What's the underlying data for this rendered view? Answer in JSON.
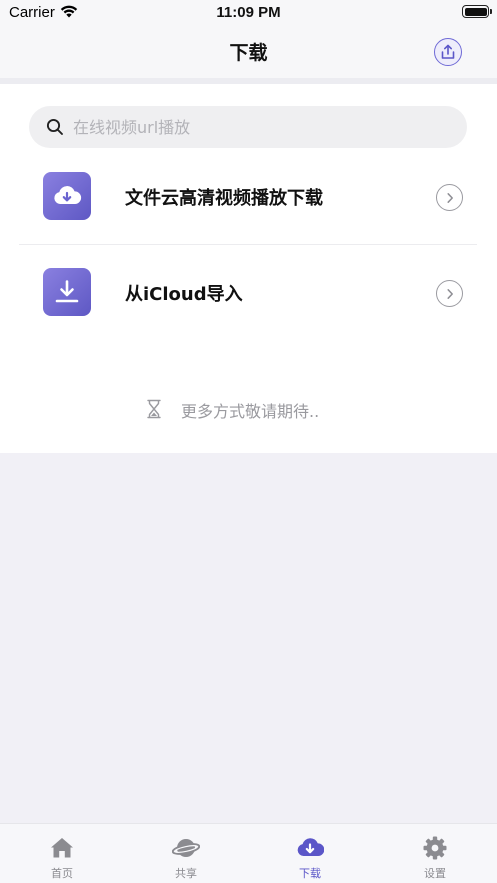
{
  "status_bar": {
    "carrier": "Carrier",
    "time": "11:09 PM"
  },
  "nav": {
    "title": "下载"
  },
  "search": {
    "placeholder": "在线视频url播放"
  },
  "list": [
    {
      "label": "文件云高清视频播放下载",
      "icon": "cloud-download-icon"
    },
    {
      "label": "从iCloud导入",
      "icon": "download-tray-icon"
    }
  ],
  "more_hint": "更多方式敬请期待..",
  "tabs": [
    {
      "label": "首页",
      "icon": "home-icon",
      "active": false
    },
    {
      "label": "共享",
      "icon": "planet-icon",
      "active": false
    },
    {
      "label": "下载",
      "icon": "cloud-download-icon",
      "active": true
    },
    {
      "label": "设置",
      "icon": "gear-icon",
      "active": false
    }
  ],
  "colors": {
    "accent": "#5b56c8",
    "icon_gradient_start": "#8a80e0",
    "icon_gradient_end": "#5e58c4",
    "tab_inactive": "#8b8b90"
  }
}
